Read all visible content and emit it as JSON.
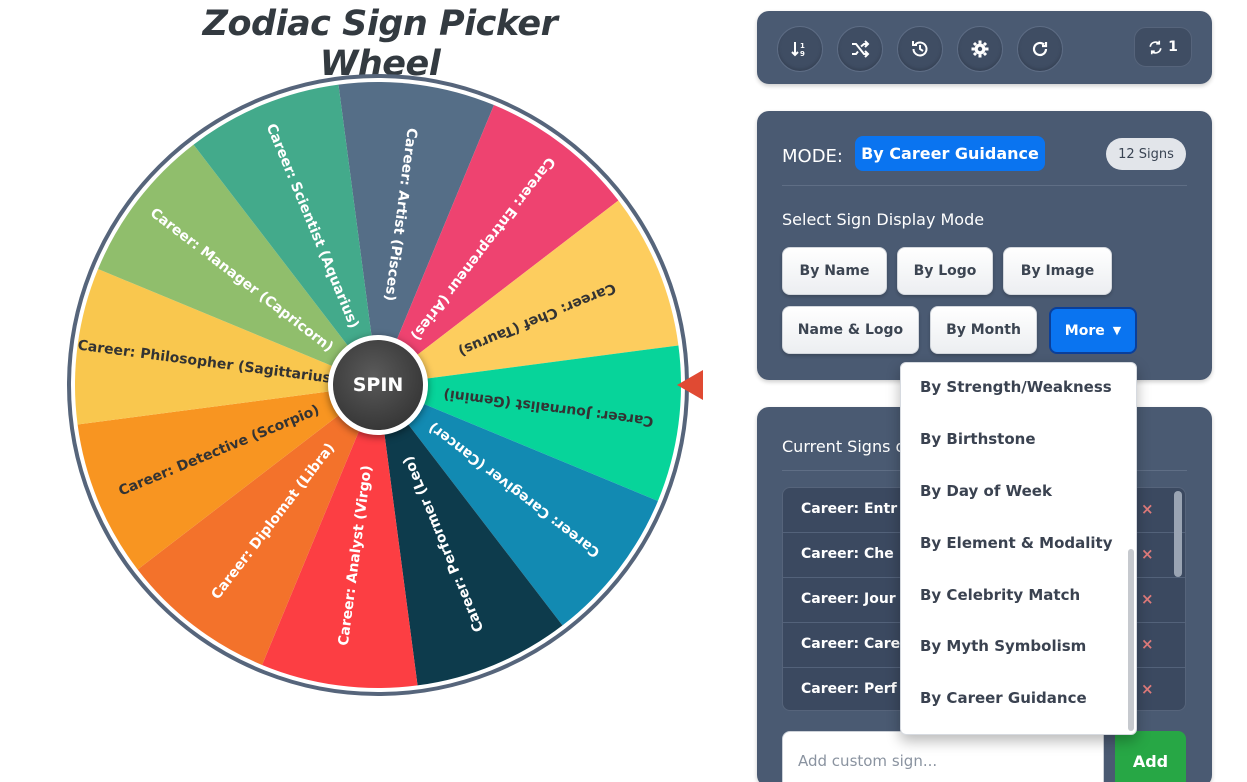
{
  "title": "Zodiac Sign Picker Wheel",
  "wheel": {
    "spin_label": "SPIN",
    "segments": [
      {
        "label": "Career: Artist (Pisces)",
        "color": "#556e87",
        "text_color": "#ffffff"
      },
      {
        "label": "Career: Entrepreneur (Aries)",
        "color": "#ee4370",
        "text_color": "#ffffff"
      },
      {
        "label": "Career: Chef (Taurus)",
        "color": "#fdcd5e",
        "text_color": "#333333"
      },
      {
        "label": "Career: Journalist (Gemini)",
        "color": "#07d49a",
        "text_color": "#333333"
      },
      {
        "label": "Career: Caregiver (Cancer)",
        "color": "#128ab2",
        "text_color": "#ffffff"
      },
      {
        "label": "Career: Performer (Leo)",
        "color": "#0d3b4c",
        "text_color": "#ffffff"
      },
      {
        "label": "Career: Analyst (Virgo)",
        "color": "#fc3e43",
        "text_color": "#ffffff"
      },
      {
        "label": "Career: Diplomat (Libra)",
        "color": "#f3722b",
        "text_color": "#ffffff"
      },
      {
        "label": "Career: Detective (Scorpio)",
        "color": "#f89521",
        "text_color": "#333333"
      },
      {
        "label": "Career: Philosopher (Sagittarius)",
        "color": "#f9c74e",
        "text_color": "#333333"
      },
      {
        "label": "Career: Manager (Capricorn)",
        "color": "#90be6c",
        "text_color": "#ffffff"
      },
      {
        "label": "Career: Scientist (Aquarius)",
        "color": "#43aa8b",
        "text_color": "#ffffff"
      }
    ]
  },
  "toolbar": {
    "icons": [
      "sort-icon",
      "shuffle-icon",
      "history-icon",
      "gear-icon",
      "refresh-icon"
    ],
    "spin_count": "1"
  },
  "mode": {
    "label": "MODE:",
    "current": "By Career Guidance",
    "signs_count": "12 Signs",
    "section_label": "Select Sign Display Mode",
    "buttons": [
      "By Name",
      "By Logo",
      "By Image",
      "Name & Logo",
      "By Month"
    ],
    "more_label": "More",
    "more_options": [
      "By Strength/Weakness",
      "By Birthstone",
      "By Day of Week",
      "By Element & Modality",
      "By Celebrity Match",
      "By Myth Symbolism",
      "By Career Guidance"
    ]
  },
  "list": {
    "title": "Current Signs o",
    "items": [
      "Career: Entr",
      "Career: Che",
      "Career: Jour",
      "Career: Care",
      "Career: Perf"
    ],
    "delete_symbol": "×",
    "input_placeholder": "Add custom sign...",
    "add_label": "Add"
  }
}
